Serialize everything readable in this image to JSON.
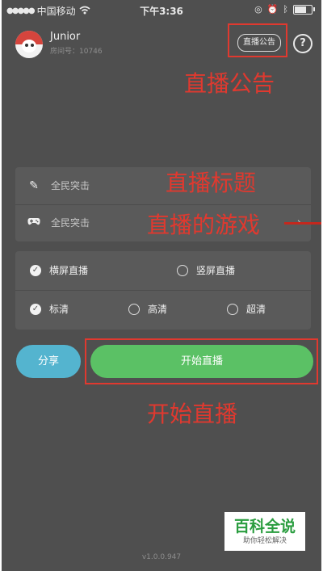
{
  "status_bar": {
    "carrier": "中国移动",
    "time": "下午3:36",
    "icons": [
      "signal-dots-icon",
      "wifi-icon",
      "lock-rotation-icon",
      "alarm-icon",
      "bluetooth-icon",
      "battery-icon"
    ]
  },
  "header": {
    "username": "Junior",
    "room_id": "房间号：10746",
    "announce_label": "直播公告",
    "help_label": "?"
  },
  "form": {
    "title_placeholder": "全民突击",
    "game_value": "全民突击"
  },
  "orientation": {
    "landscape": "横屏直播",
    "portrait": "竖屏直播",
    "selected": "横屏直播"
  },
  "quality": {
    "sd": "标清",
    "hd": "高清",
    "uhd": "超清",
    "selected": "标清"
  },
  "actions": {
    "share_label": "分享",
    "start_label": "开始直播"
  },
  "annotations": {
    "announcement": "直播公告",
    "title": "直播标题",
    "game": "直播的游戏",
    "start": "开始直播"
  },
  "watermark": {
    "title": "百科全说",
    "subtitle": "助你轻松解决"
  },
  "version": "v1.0.0.947",
  "colors": {
    "background": "#4f4f4f",
    "panel": "#5a5a5a",
    "share": "#54b4cf",
    "start": "#5bc165",
    "annotation": "#e0392f"
  }
}
